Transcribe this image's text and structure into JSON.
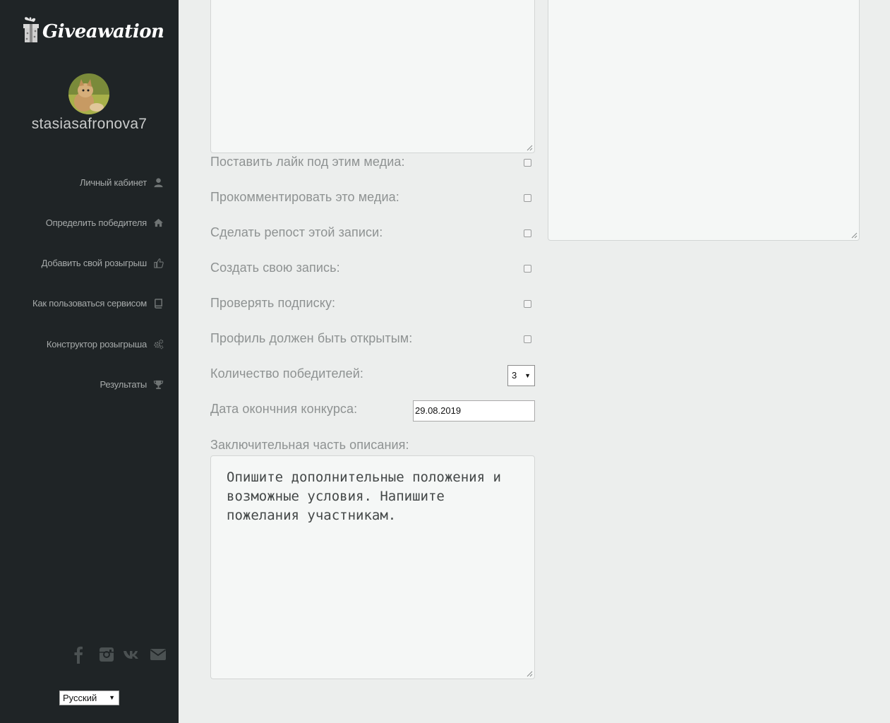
{
  "brand": {
    "name": "Giveawation"
  },
  "user": {
    "username": "stasiasafronova7"
  },
  "sidebar": {
    "items": [
      {
        "label": "Личный кабинет",
        "icon": "user-icon"
      },
      {
        "label": "Определить победителя",
        "icon": "home-icon"
      },
      {
        "label": "Добавить свой розыгрыш",
        "icon": "thumbs-up-icon"
      },
      {
        "label": "Как пользоваться сервисом",
        "icon": "book-icon"
      },
      {
        "label": "Конструктор розыгрыша",
        "icon": "gears-icon"
      },
      {
        "label": "Результаты",
        "icon": "trophy-icon"
      }
    ],
    "socials": [
      "facebook-icon",
      "instagram-icon",
      "vk-icon",
      "envelope-icon"
    ],
    "language": {
      "selected": "Русский"
    }
  },
  "form": {
    "options": [
      {
        "label": "Поставить лайк под этим медиа:",
        "checked": false
      },
      {
        "label": "Прокомментировать это медиа:",
        "checked": false
      },
      {
        "label": "Сделать репост этой записи:",
        "checked": false
      },
      {
        "label": "Создать свою запись:",
        "checked": false
      },
      {
        "label": "Проверять подписку:",
        "checked": false
      },
      {
        "label": "Профиль должен быть открытым:",
        "checked": false
      }
    ],
    "winners": {
      "label": "Количество победителей:",
      "value": "3"
    },
    "end_date": {
      "label": "Дата окончния конкурса:",
      "value": "29.08.2019"
    },
    "final_part": {
      "label": "Заключительная часть описания:",
      "placeholder": "Опишите дополнительные положения и возможные условия. Напишите пожелания участникам."
    }
  },
  "colors": {
    "sidebar_bg": "#1f2426",
    "main_bg": "#eceeed",
    "label_text": "#8e9292",
    "nav_text": "#a7abab"
  }
}
